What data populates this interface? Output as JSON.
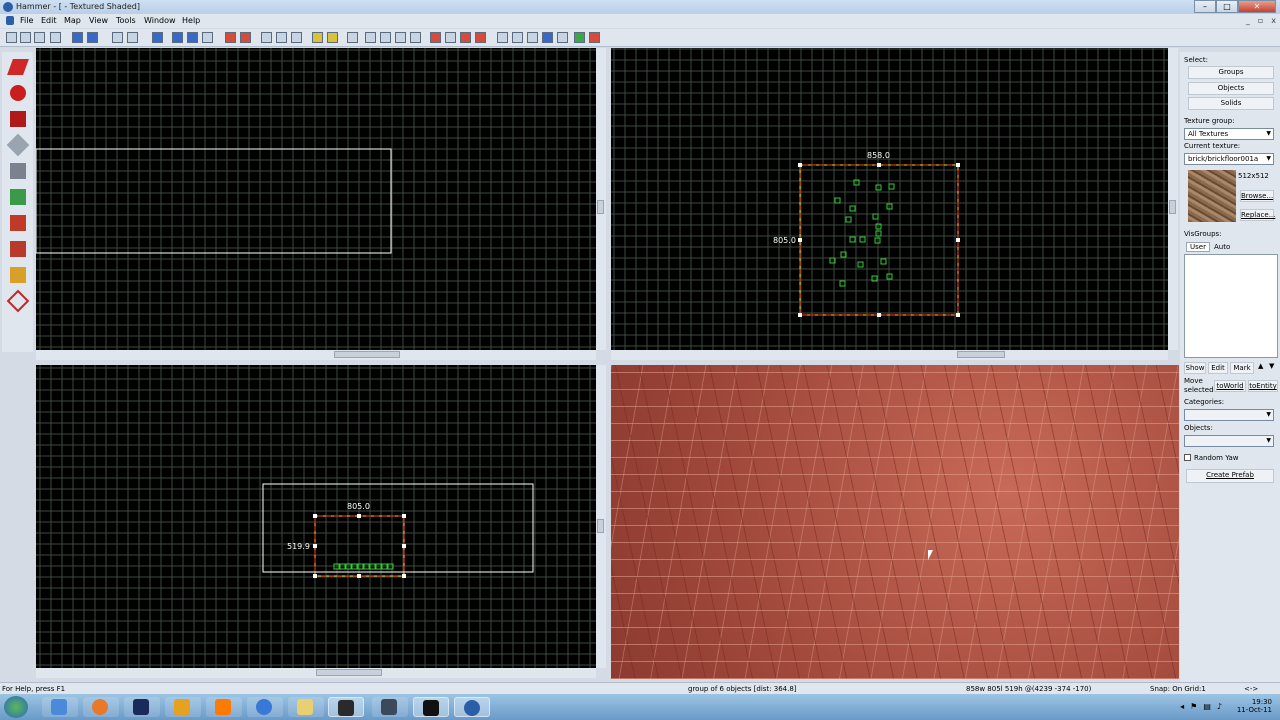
{
  "window": {
    "title": "Hammer - [ - Textured Shaded]",
    "minimize": "–",
    "maximize": "□",
    "close": "✕",
    "mdi_minimize": "_",
    "mdi_restore": "▫",
    "mdi_close": "x"
  },
  "menu": {
    "items": [
      "File",
      "Edit",
      "Map",
      "View",
      "Tools",
      "Window",
      "Help"
    ]
  },
  "views": {
    "top_right": {
      "dim_top": "858.0",
      "dim_left": "805.0"
    },
    "bottom_left": {
      "dim_top": "805.0",
      "dim_left": "519.9"
    }
  },
  "right_panel": {
    "select_label": "Select:",
    "groups_btn": "Groups",
    "objects_btn": "Objects",
    "solids_btn": "Solids",
    "texture_group_label": "Texture group:",
    "texture_group_value": "All Textures",
    "current_texture_label": "Current texture:",
    "current_texture_value": "brick/brickfloor001a",
    "texture_size": "512x512",
    "browse_btn": "Browse...",
    "replace_btn": "Replace...",
    "visgroups_label": "VisGroups:",
    "tab_user": "User",
    "tab_auto": "Auto",
    "show_btn": "Show",
    "edit_btn": "Edit",
    "mark_btn": "Mark",
    "move_selected_label": "Move selected:",
    "to_world_btn": "toWorld",
    "to_entity_btn": "toEntity",
    "categories_label": "Categories:",
    "objects_label": "Objects:",
    "random_yaw_label": "Random Yaw",
    "create_prefab_btn": "Create Prefab"
  },
  "status": {
    "help": "For Help, press F1",
    "selection": "group of 6 objects   [dist: 364.8]",
    "size": "858w 805l 519h @(4239 -374 -170)",
    "snap": "Snap: On Grid:1",
    "nav": "<->"
  },
  "taskbar": {
    "time": "19:30",
    "date": "11-Oct-11"
  },
  "colors": {
    "grid_line": "#3d4a3d",
    "grid_major": "#5a6b5a",
    "selection_box": "#ff3b1f",
    "selection_dash": "#ffd21a",
    "entity": "#33cc33",
    "brush_outline": "#ffffff",
    "texture_base": "#b45646"
  }
}
